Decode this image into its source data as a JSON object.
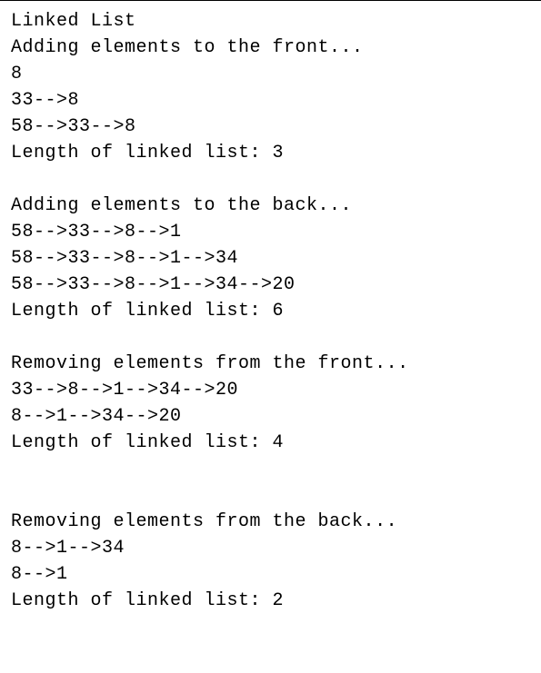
{
  "lines": [
    "Linked List",
    "Adding elements to the front...",
    "8",
    "33-->8",
    "58-->33-->8",
    "Length of linked list: 3",
    "",
    "Adding elements to the back...",
    "58-->33-->8-->1",
    "58-->33-->8-->1-->34",
    "58-->33-->8-->1-->34-->20",
    "Length of linked list: 6",
    "",
    "Removing elements from the front...",
    "33-->8-->1-->34-->20",
    "8-->1-->34-->20",
    "Length of linked list: 4",
    "",
    "",
    "Removing elements from the back...",
    "8-->1-->34",
    "8-->1",
    "Length of linked list: 2"
  ]
}
